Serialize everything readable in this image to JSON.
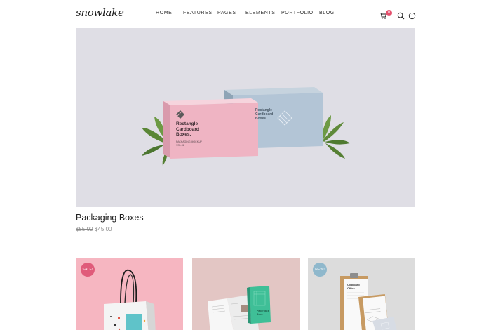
{
  "header": {
    "logo": "snowlake",
    "nav": [
      "HOME",
      "FEATURES",
      "PAGES",
      "ELEMENTS",
      "PORTFOLIO",
      "BLOG"
    ],
    "cart_count": "0"
  },
  "hero": {
    "box_front_text": [
      "Rectangle",
      "Cardboard",
      "Boxes."
    ],
    "box_front_sub": [
      "PACKAGING MOCKUP",
      "VOL.02"
    ],
    "box_back_text": [
      "Rectangle",
      "Cardboard",
      "Boxes."
    ]
  },
  "product": {
    "title": "Packaging Boxes",
    "old_price": "$55.00",
    "new_price": "$45.00"
  },
  "cards": [
    {
      "tag": "SALE!",
      "color": "#f6b6c1"
    },
    {
      "tag": "",
      "color": "#e3c6c4",
      "book_title": [
        "Paperback",
        "Book"
      ]
    },
    {
      "tag": "NEW!",
      "color": "#dcdcdc",
      "clip_title": [
        "Clipboard",
        "Office"
      ]
    }
  ],
  "colors": {
    "accent": "#e4506d",
    "hero_bg": "#dfdee5"
  },
  "icons": [
    "cart-icon",
    "search-icon",
    "info-icon"
  ]
}
